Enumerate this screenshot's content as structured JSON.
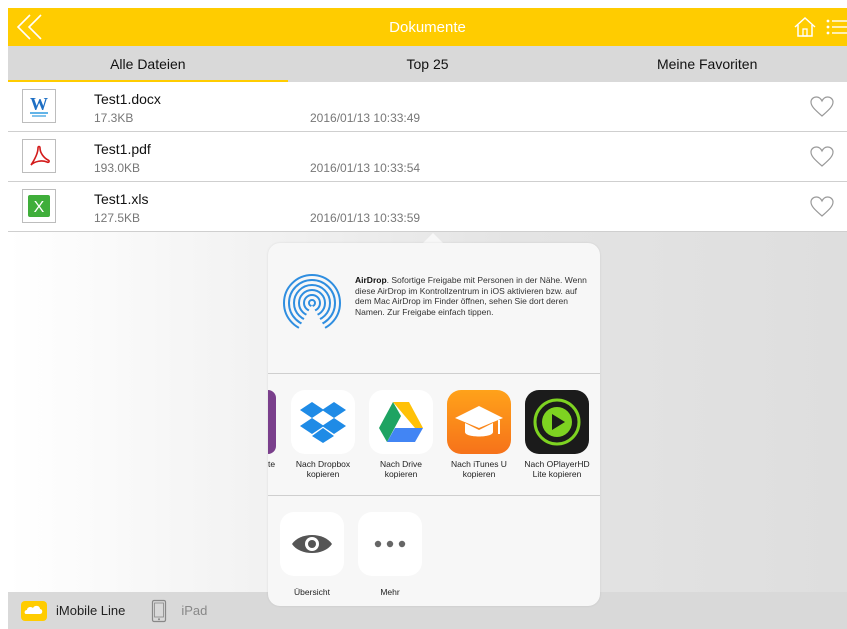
{
  "header": {
    "title": "Dokumente"
  },
  "tabs": [
    {
      "label": "Alle Dateien",
      "active": true
    },
    {
      "label": "Top 25",
      "active": false
    },
    {
      "label": "Meine Favoriten",
      "active": false
    }
  ],
  "files": [
    {
      "name": "Test1.docx",
      "size": "17.3KB",
      "date": "2016/01/13 10:33:49",
      "icon": "word-doc-icon"
    },
    {
      "name": "Test1.pdf",
      "size": "193.0KB",
      "date": "2016/01/13 10:33:54",
      "icon": "pdf-doc-icon"
    },
    {
      "name": "Test1.xls",
      "size": "127.5KB",
      "date": "2016/01/13 10:33:59",
      "icon": "excel-doc-icon"
    }
  ],
  "share_sheet": {
    "airdrop_title": "AirDrop",
    "airdrop_text": ". Sofortige Freigabe mit Personen in der Nähe. Wenn diese AirDrop im Kontrollzentrum in iOS aktivieren bzw. auf dem Mac AirDrop im Finder öffnen, sehen Sie dort deren Namen. Zur Freigabe einfach tippen.",
    "partial_app_label": "te",
    "apps": [
      {
        "label": "Nach Dropbox kopieren",
        "icon": "dropbox-icon"
      },
      {
        "label": "Nach Drive kopieren",
        "icon": "google-drive-icon"
      },
      {
        "label": "Nach iTunes U kopieren",
        "icon": "itunes-u-icon"
      },
      {
        "label": "Nach OPlayerHD Lite kopieren",
        "icon": "oplayer-icon"
      }
    ],
    "actions": [
      {
        "label": "Übersicht",
        "icon": "eye-icon"
      },
      {
        "label": "Mehr",
        "icon": "more-dots-icon"
      }
    ]
  },
  "bottom_bar": {
    "item1": "iMobile Line",
    "item2": "iPad"
  },
  "colors": {
    "accent": "#ffcc00",
    "tab_bg": "#d9d9d9"
  }
}
